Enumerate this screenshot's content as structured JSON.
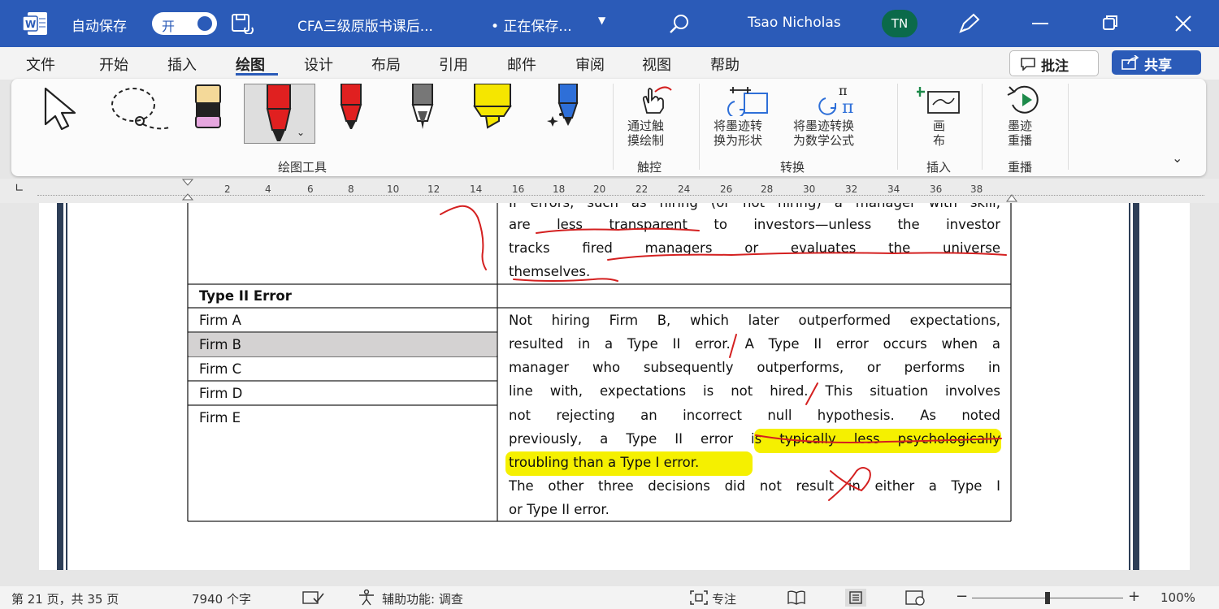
{
  "titlebar": {
    "autosave_label": "自动保存",
    "autosave_state": "开",
    "doc_title": "CFA三级原版书课后...",
    "save_status": "• 正在保存...",
    "user_name": "Tsao Nicholas",
    "user_initials": "TN",
    "colors": {
      "bar": "#2b5bb8",
      "avatar": "#0b6a4a"
    }
  },
  "menu": {
    "tabs": [
      "文件",
      "开始",
      "插入",
      "绘图",
      "设计",
      "布局",
      "引用",
      "邮件",
      "审阅",
      "视图",
      "帮助"
    ],
    "active_tab": "绘图",
    "comment_button": "批注",
    "share_button": "共享"
  },
  "ribbon": {
    "group_draw_tools": "绘图工具",
    "touch_draw_label_1": "通过触",
    "touch_draw_label_2": "摸绘制",
    "group_touch": "触控",
    "ink_to_shape_1": "将墨迹转",
    "ink_to_shape_2": "换为形状",
    "ink_to_math_1": "将墨迹转换",
    "ink_to_math_2": "为数学公式",
    "group_convert": "转换",
    "canvas_1": "画",
    "canvas_2": "布",
    "group_insert": "插入",
    "replay_1": "墨迹",
    "replay_2": "重播",
    "group_replay": "重播",
    "pen_colors": {
      "red": "#e02020",
      "highlighter": "#f5e600",
      "blue": "#2e6fd8"
    }
  },
  "ruler": {
    "ticks": [
      "2",
      "4",
      "6",
      "8",
      "10",
      "12",
      "14",
      "16",
      "18",
      "20",
      "22",
      "24",
      "26",
      "28",
      "30",
      "32",
      "34",
      "36",
      "38"
    ]
  },
  "document": {
    "top_partial_line": "If errors, such as hiring (or not hiring) a manager with skill,",
    "top_lines": [
      "are less transparent to investors—unless the investor",
      "tracks fired managers or evaluates the universe",
      "themselves."
    ],
    "section_header": "Type II Error",
    "firms": [
      "Firm A",
      "Firm B",
      "Firm C",
      "Firm D",
      "Firm E"
    ],
    "selected_firm_index": 1,
    "body_lines": [
      "Not hiring Firm B, which later outperformed expectations,",
      "resulted in a Type II error. A Type II error occurs when a",
      "manager who subsequently outperforms, or performs in",
      "line with, expectations is not hired. This situation involves",
      "not rejecting an incorrect null hypothesis. As noted",
      "previously, a Type II error is typically less psychologically",
      "troubling than a Type I error.",
      "The other three decisions did not result in either a Type I",
      "or Type II error."
    ],
    "highlight_color": "#f5f000",
    "ink_color": "#d42020"
  },
  "statusbar": {
    "page_info": "第 21 页，共 35 页",
    "word_count": "7940 个字",
    "accessibility": "辅助功能: 调查",
    "focus": "专注",
    "zoom": "100%"
  }
}
